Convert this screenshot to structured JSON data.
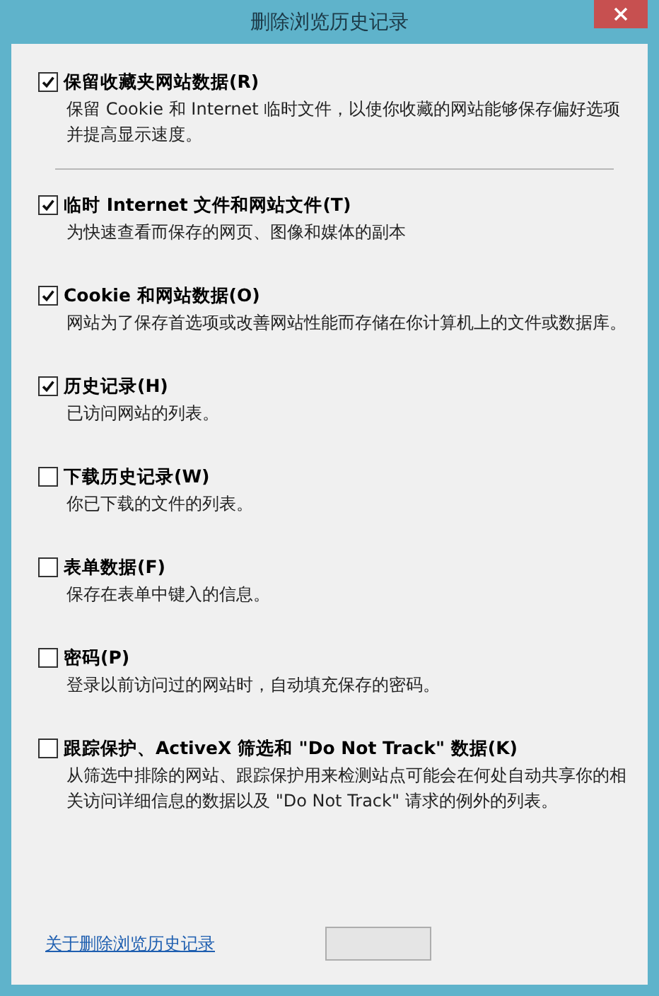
{
  "window": {
    "title": "删除浏览历史记录"
  },
  "options": [
    {
      "label": "保留收藏夹网站数据(R)",
      "description": "保留 Cookie 和 Internet 临时文件，以使你收藏的网站能够保存偏好选项并提高显示速度。",
      "checked": true
    },
    {
      "label": "临时 Internet 文件和网站文件(T)",
      "description": "为快速查看而保存的网页、图像和媒体的副本",
      "checked": true
    },
    {
      "label": "Cookie 和网站数据(O)",
      "description": "网站为了保存首选项或改善网站性能而存储在你计算机上的文件或数据库。",
      "checked": true
    },
    {
      "label": "历史记录(H)",
      "description": "已访问网站的列表。",
      "checked": true
    },
    {
      "label": "下载历史记录(W)",
      "description": "你已下载的文件的列表。",
      "checked": false
    },
    {
      "label": "表单数据(F)",
      "description": "保存在表单中键入的信息。",
      "checked": false
    },
    {
      "label": "密码(P)",
      "description": "登录以前访问过的网站时，自动填充保存的密码。",
      "checked": false
    },
    {
      "label": "跟踪保护、ActiveX 筛选和 \"Do Not Track\" 数据(K)",
      "description": "从筛选中排除的网站、跟踪保护用来检测站点可能会在何处自动共享你的相关访问详细信息的数据以及 \"Do Not Track\" 请求的例外的列表。",
      "checked": false
    }
  ],
  "footer": {
    "link": "关于删除浏览历史记录"
  }
}
